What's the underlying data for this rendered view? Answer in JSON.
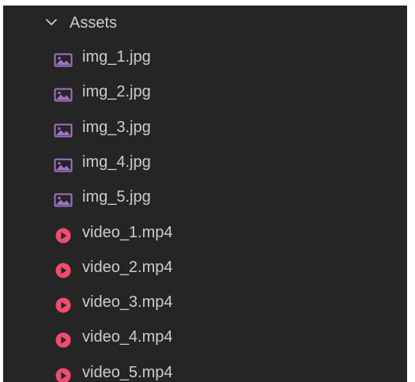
{
  "explorer": {
    "folder": {
      "name": "Assets",
      "icon": "chevron-down-icon"
    },
    "files": [
      {
        "name": "img_1.jpg",
        "type": "image",
        "icon": "image-file-icon",
        "color": "#a074c4"
      },
      {
        "name": "img_2.jpg",
        "type": "image",
        "icon": "image-file-icon",
        "color": "#a074c4"
      },
      {
        "name": "img_3.jpg",
        "type": "image",
        "icon": "image-file-icon",
        "color": "#a074c4"
      },
      {
        "name": "img_4.jpg",
        "type": "image",
        "icon": "image-file-icon",
        "color": "#a074c4"
      },
      {
        "name": "img_5.jpg",
        "type": "image",
        "icon": "image-file-icon",
        "color": "#a074c4"
      },
      {
        "name": "video_1.mp4",
        "type": "video",
        "icon": "video-file-icon",
        "color": "#f14c6e"
      },
      {
        "name": "video_2.mp4",
        "type": "video",
        "icon": "video-file-icon",
        "color": "#f14c6e"
      },
      {
        "name": "video_3.mp4",
        "type": "video",
        "icon": "video-file-icon",
        "color": "#f14c6e"
      },
      {
        "name": "video_4.mp4",
        "type": "video",
        "icon": "video-file-icon",
        "color": "#f14c6e"
      },
      {
        "name": "video_5.mp4",
        "type": "video",
        "icon": "video-file-icon",
        "color": "#f14c6e"
      }
    ]
  }
}
